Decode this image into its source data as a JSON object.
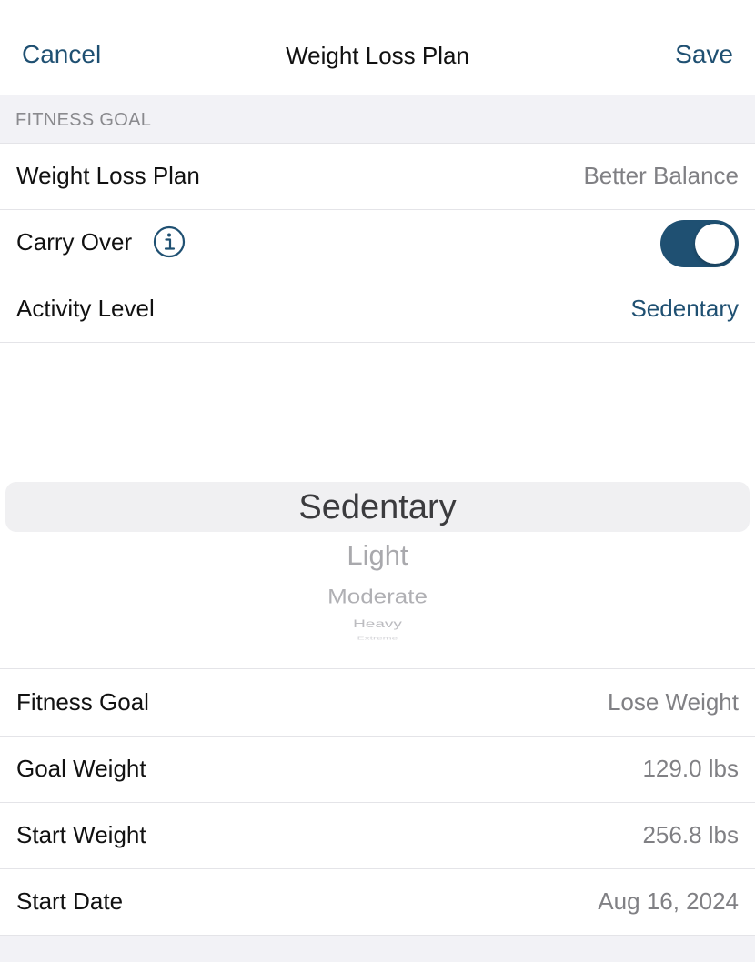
{
  "nav": {
    "cancel_label": "Cancel",
    "title": "Weight Loss Plan",
    "save_label": "Save"
  },
  "section_header": "FITNESS GOAL",
  "rows": {
    "plan": {
      "label": "Weight Loss Plan",
      "value": "Better Balance"
    },
    "carry_over": {
      "label": "Carry Over",
      "toggle_on": true,
      "icon": "info-icon"
    },
    "activity": {
      "label": "Activity Level",
      "value": "Sedentary"
    },
    "fitness_goal": {
      "label": "Fitness Goal",
      "value": "Lose Weight"
    },
    "goal_weight": {
      "label": "Goal Weight",
      "value": "129.0 lbs"
    },
    "start_weight": {
      "label": "Start Weight",
      "value": "256.8 lbs"
    },
    "start_date": {
      "label": "Start Date",
      "value": "Aug 16, 2024"
    }
  },
  "picker": {
    "options": [
      "Sedentary",
      "Light",
      "Moderate",
      "Heavy",
      "Extreme"
    ],
    "selected": "Sedentary"
  },
  "colors": {
    "accent": "#1f5072",
    "secondary_text": "#808084",
    "group_background": "#f2f2f6"
  }
}
